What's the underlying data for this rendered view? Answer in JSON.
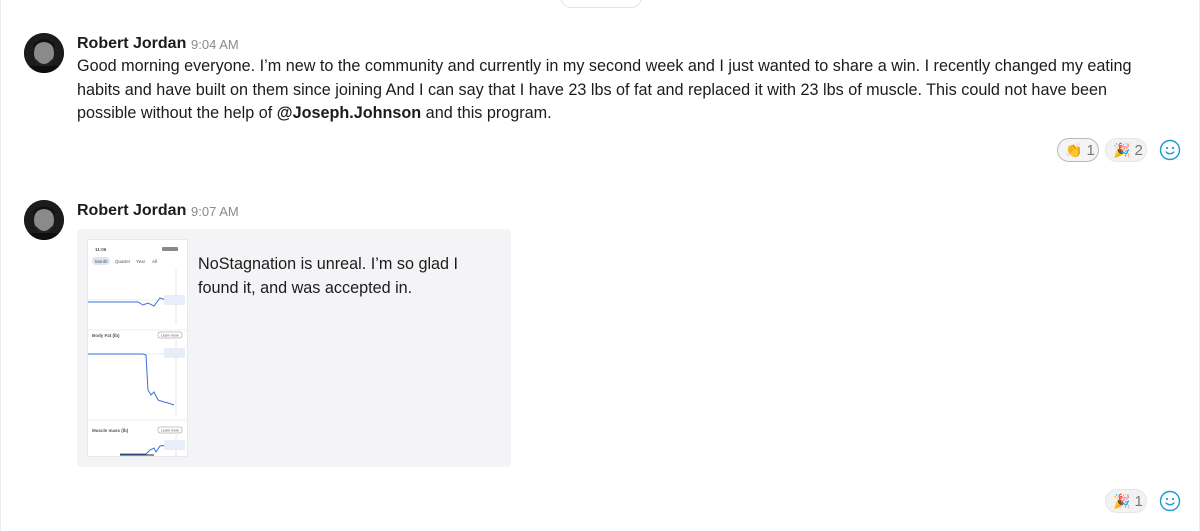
{
  "messages": [
    {
      "author": "Robert Jordan",
      "time": "9:04 AM",
      "text_before": "Good morning everyone. I’m new to the community and currently in my second week and I just wanted to share a win. I recently changed my eating habits and have built on them since joining And I can say that I have 23 lbs of fat and replaced it with 23 lbs of muscle. This could not have been possible without the help of ",
      "mention": "@Joseph.Johnson",
      "text_after": " and this program.",
      "reactions": [
        {
          "emoji": "👏",
          "icon": "clapping-hands-icon",
          "count": "1",
          "active": true
        },
        {
          "emoji": "🎉",
          "icon": "party-popper-icon",
          "count": "2",
          "active": false
        }
      ]
    },
    {
      "author": "Robert Jordan",
      "time": "9:07 AM",
      "card_text": "NoStagnation is unreal. I’m so glad I found it, and was accepted in.",
      "screenshot": {
        "status_time": "11:06",
        "tabs": [
          "Month",
          "Quarter",
          "Year",
          "All"
        ],
        "sections": [
          "Body Fat (lb)",
          "Muscle mass (lb)"
        ],
        "learn_more": "Learn more"
      },
      "reactions": [
        {
          "emoji": "🎉",
          "icon": "party-popper-icon",
          "count": "1",
          "active": false
        }
      ]
    }
  ],
  "colors": {
    "accent": "#1d9bd1",
    "text": "#1d1c1d",
    "muted": "#8a8a8a",
    "card_bg": "#f4f4f6"
  }
}
